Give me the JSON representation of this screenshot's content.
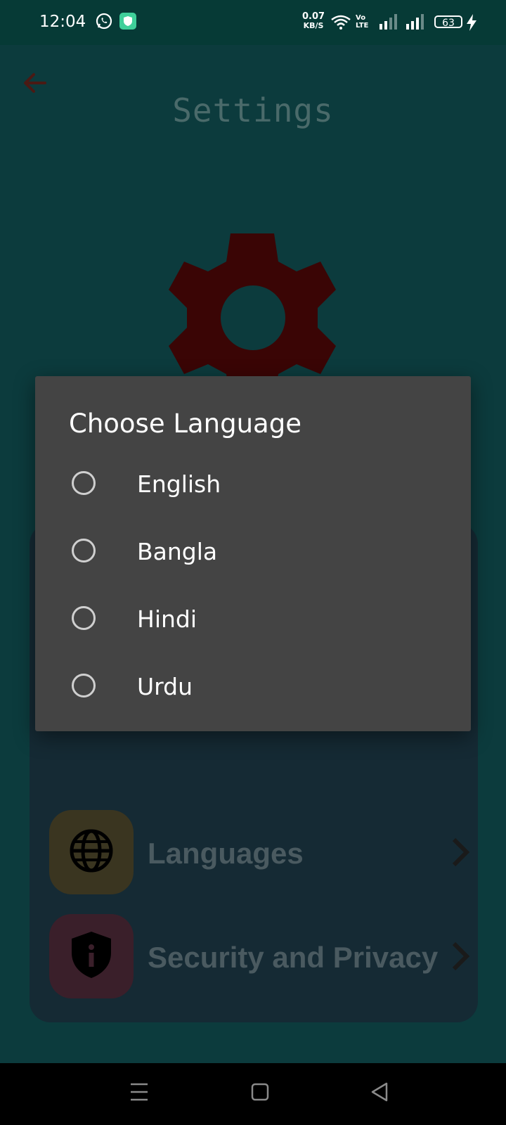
{
  "status_bar": {
    "time": "12:04",
    "net_speed_value": "0.07",
    "net_speed_unit": "KB/S",
    "volte_top": "Vo",
    "volte_bottom": "LTE",
    "battery_level": "63",
    "icons": [
      "whatsapp-icon",
      "shield-app-icon",
      "wifi-icon",
      "signal-icon",
      "signal-icon",
      "battery-icon",
      "charging-icon"
    ]
  },
  "header": {
    "title": "Settings",
    "back_icon": "arrow-left-icon"
  },
  "hero_icon": "gear-icon",
  "menu": {
    "items": [
      {
        "label": "Languages",
        "icon": "globe-icon",
        "icon_bg": "#3a3520"
      },
      {
        "label": "Security and Privacy",
        "icon": "shield-info-icon",
        "icon_bg": "#3a1f2a"
      }
    ]
  },
  "dialog": {
    "title": "Choose Language",
    "options": [
      {
        "label": "English",
        "selected": false
      },
      {
        "label": "Bangla",
        "selected": false
      },
      {
        "label": "Hindi",
        "selected": false
      },
      {
        "label": "Urdu",
        "selected": false
      }
    ]
  },
  "nav_bar": {
    "buttons": [
      "menu-icon",
      "home-icon",
      "back-triangle-icon"
    ]
  },
  "colors": {
    "page_bg": "#0c3b3d",
    "status_bar_bg": "#063a36",
    "dialog_bg": "#444444",
    "gear": "#3a0505",
    "card_bg": "#152a34"
  }
}
